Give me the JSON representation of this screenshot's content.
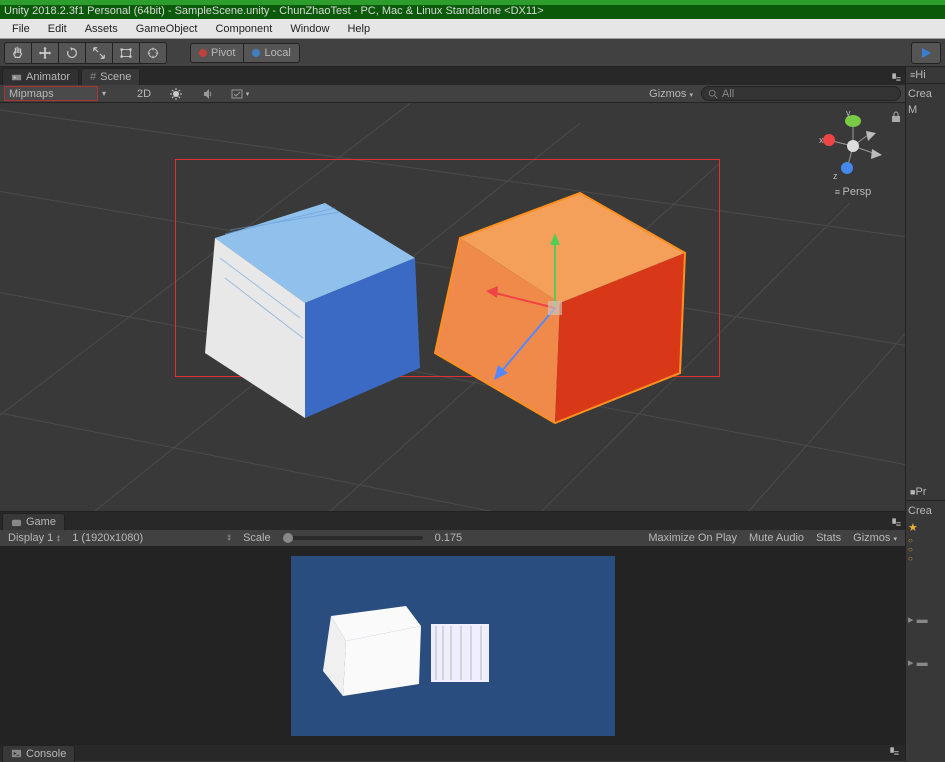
{
  "title": "Unity 2018.2.3f1 Personal (64bit) - SampleScene.unity - ChunZhaoTest - PC, Mac & Linux Standalone  <DX11>",
  "menu": [
    "File",
    "Edit",
    "Assets",
    "GameObject",
    "Component",
    "Window",
    "Help"
  ],
  "toolbar": {
    "pivot": "Pivot",
    "local": "Local"
  },
  "tabs": {
    "animator": "Animator",
    "scene": "Scene",
    "game": "Game",
    "console": "Console"
  },
  "sceneCtl": {
    "shading": "Mipmaps",
    "twoD": "2D",
    "gizmos": "Gizmos",
    "all": "All"
  },
  "gizmo": {
    "x": "x",
    "y": "y",
    "z": "z",
    "persp": "Persp"
  },
  "game": {
    "display": "Display 1",
    "res": "1 (1920x1080)",
    "scaleLabel": "Scale",
    "scale": "0.175",
    "maximize": "Maximize On Play",
    "mute": "Mute Audio",
    "stats": "Stats",
    "gizmos": "Gizmos"
  },
  "right": {
    "hierarchy": "Hi",
    "create": "Crea",
    "project": "Pr",
    "create2": "Crea",
    "m": "M"
  }
}
